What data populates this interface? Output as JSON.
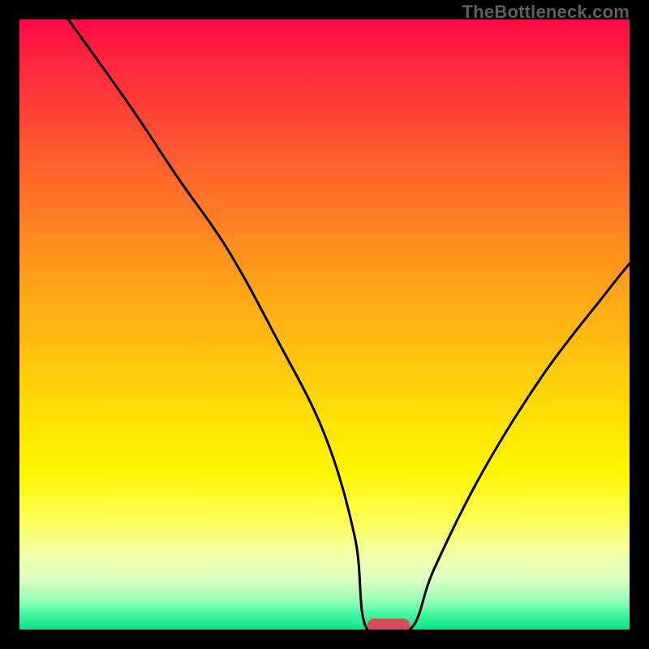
{
  "watermark": "TheBottleneck.com",
  "chart_data": {
    "type": "line",
    "title": "",
    "xlabel": "",
    "ylabel": "",
    "xlim": [
      0,
      100
    ],
    "ylim": [
      0,
      100
    ],
    "notch_x_range": [
      57,
      64
    ],
    "series": [
      {
        "name": "bottleneck-curve",
        "x": [
          8,
          18,
          26,
          34,
          42,
          50,
          55,
          57,
          64,
          68,
          76,
          86,
          96,
          100
        ],
        "values": [
          100,
          86,
          74,
          62.5,
          48,
          32,
          15,
          0,
          0,
          10,
          26,
          42,
          55,
          60
        ]
      }
    ],
    "marker": {
      "x": 60.5,
      "y": 0.7,
      "width": 7,
      "height": 2.2,
      "color": "#d94a5a"
    }
  }
}
